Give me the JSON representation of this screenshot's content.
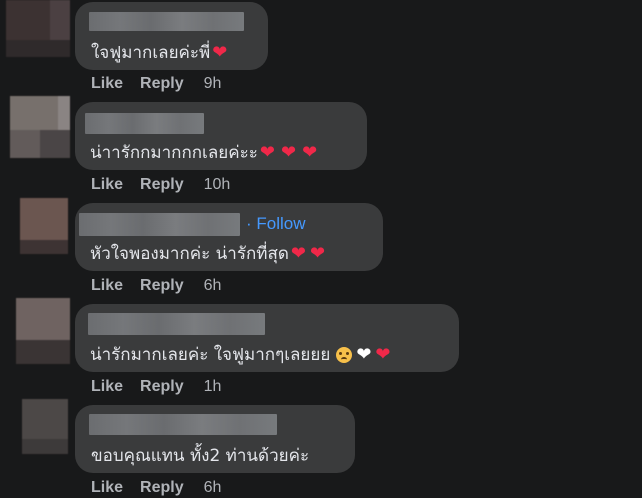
{
  "comments": [
    {
      "text": "ใจฟูมากเลยค่ะพี่",
      "reactions": [
        "red-heart"
      ],
      "follow_label": "",
      "like_label": "Like",
      "reply_label": "Reply",
      "time": "9h"
    },
    {
      "text": "น่าารักกมากกกเลยค่ะะ",
      "reactions": [
        "red-heart",
        "red-heart",
        "red-heart"
      ],
      "follow_label": "",
      "like_label": "Like",
      "reply_label": "Reply",
      "time": "10h"
    },
    {
      "text": "หัวใจพองมากค่ะ น่ารักที่สุด",
      "reactions": [
        "red-heart",
        "red-heart"
      ],
      "follow_label": "· Follow",
      "like_label": "Like",
      "reply_label": "Reply",
      "time": "6h"
    },
    {
      "text": "น่ารักมากเลยค่ะ ใจฟูมากๆเลยยย",
      "reactions": [
        "pleading-face",
        "white-heart",
        "red-heart"
      ],
      "follow_label": "",
      "like_label": "Like",
      "reply_label": "Reply",
      "time": "1h"
    },
    {
      "text": "ขอบคุณแทน ทั้ง2 ท่านด้วยค่ะ",
      "reactions": [],
      "follow_label": "",
      "like_label": "Like",
      "reply_label": "Reply",
      "time": "6h"
    }
  ],
  "colors": {
    "background": "#18191a",
    "bubble": "#3a3b3c",
    "text": "#e4e6eb",
    "secondary_text": "#b0b3b8",
    "link": "#4599ff",
    "heart": "#f02849"
  }
}
